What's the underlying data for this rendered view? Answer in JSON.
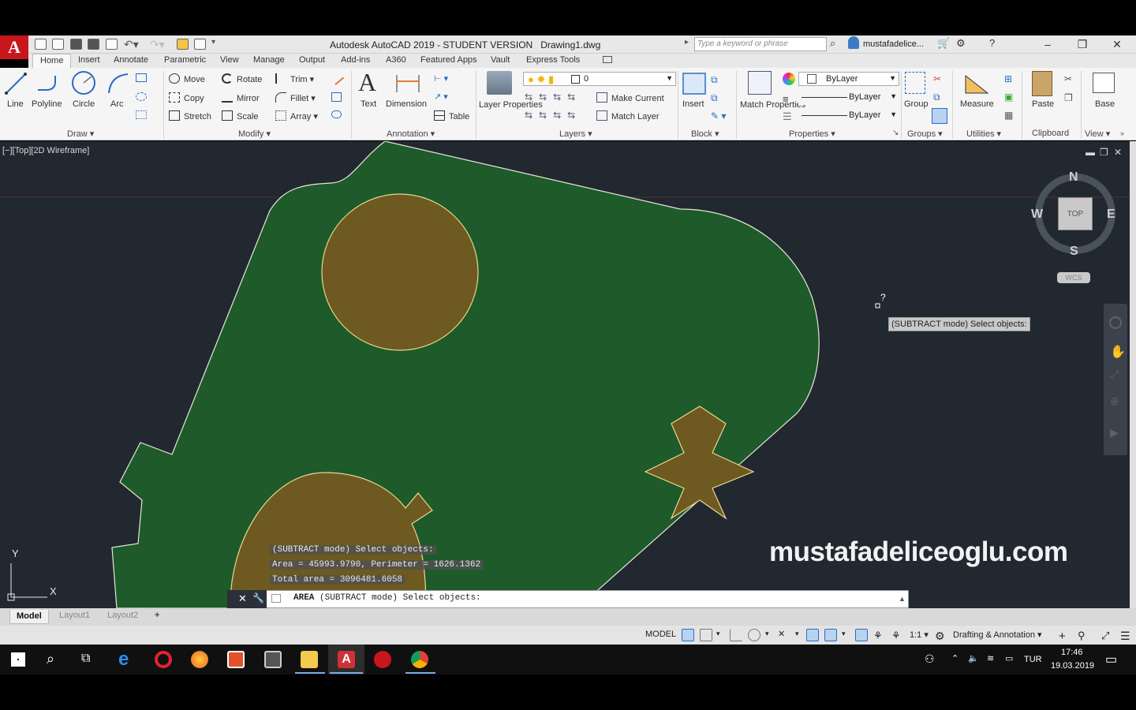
{
  "app": {
    "title": "Autodesk AutoCAD 2019 - STUDENT VERSION",
    "file": "Drawing1.dwg",
    "logo": "A",
    "search_placeholder": "Type a keyword or phrase",
    "user": "mustafadelice..."
  },
  "tabs": [
    "Home",
    "Insert",
    "Annotate",
    "Parametric",
    "View",
    "Manage",
    "Output",
    "Add-ins",
    "A360",
    "Featured Apps",
    "Vault",
    "Express Tools"
  ],
  "ribbon": {
    "draw": {
      "title": "Draw",
      "line": "Line",
      "polyline": "Polyline",
      "circle": "Circle",
      "arc": "Arc"
    },
    "modify": {
      "title": "Modify",
      "move": "Move",
      "rotate": "Rotate",
      "trim": "Trim",
      "copy": "Copy",
      "mirror": "Mirror",
      "fillet": "Fillet",
      "stretch": "Stretch",
      "scale": "Scale",
      "array": "Array"
    },
    "annotation": {
      "title": "Annotation",
      "text": "Text",
      "dimension": "Dimension",
      "table": "Table"
    },
    "layers": {
      "title": "Layers",
      "layer_properties": "Layer Properties",
      "current_layer": "0",
      "make_current": "Make Current",
      "match_layer": "Match Layer"
    },
    "block": {
      "title": "Block",
      "insert": "Insert"
    },
    "properties": {
      "title": "Properties",
      "match_properties": "Match Properties",
      "color": "ByLayer",
      "linetype": "ByLayer",
      "lineweight": "ByLayer"
    },
    "groups": {
      "title": "Groups",
      "group": "Group"
    },
    "utilities": {
      "title": "Utilities",
      "measure": "Measure"
    },
    "clipboard": {
      "title": "Clipboard",
      "paste": "Paste"
    },
    "view": {
      "title": "View",
      "base": "Base"
    }
  },
  "viewport": {
    "label": "[−][Top][2D Wireframe]",
    "viewcube": {
      "n": "N",
      "s": "S",
      "e": "E",
      "w": "W",
      "top": "TOP",
      "wcs": "WCS"
    },
    "ucs": {
      "x": "X",
      "y": "Y"
    },
    "tooltip": "(SUBTRACT mode) Select objects:",
    "cursor_mark": "?",
    "watermark": "mustafadeliceoglu.com"
  },
  "command": {
    "history": [
      "(SUBTRACT mode) Select objects:",
      "Area = 45993.9790, Perimeter = 1626.1362",
      "Total area = 3096481.6058"
    ],
    "prompt_cmd": "AREA",
    "prompt": "(SUBTRACT mode) Select objects:"
  },
  "layout_tabs": [
    "Model",
    "Layout1",
    "Layout2",
    "+"
  ],
  "status": {
    "model": "MODEL",
    "scale": "1:1",
    "workspace": "Drafting & Annotation"
  },
  "taskbar": {
    "lang": "TUR",
    "time": "17:46",
    "date": "19.03.2019"
  },
  "colors": {
    "shape_fill": "#1e5a2a",
    "hole_fill": "#6e5a20",
    "outline": "#e8e8d8",
    "viewport_bg": "#212830",
    "brand_red": "#c8161d"
  }
}
